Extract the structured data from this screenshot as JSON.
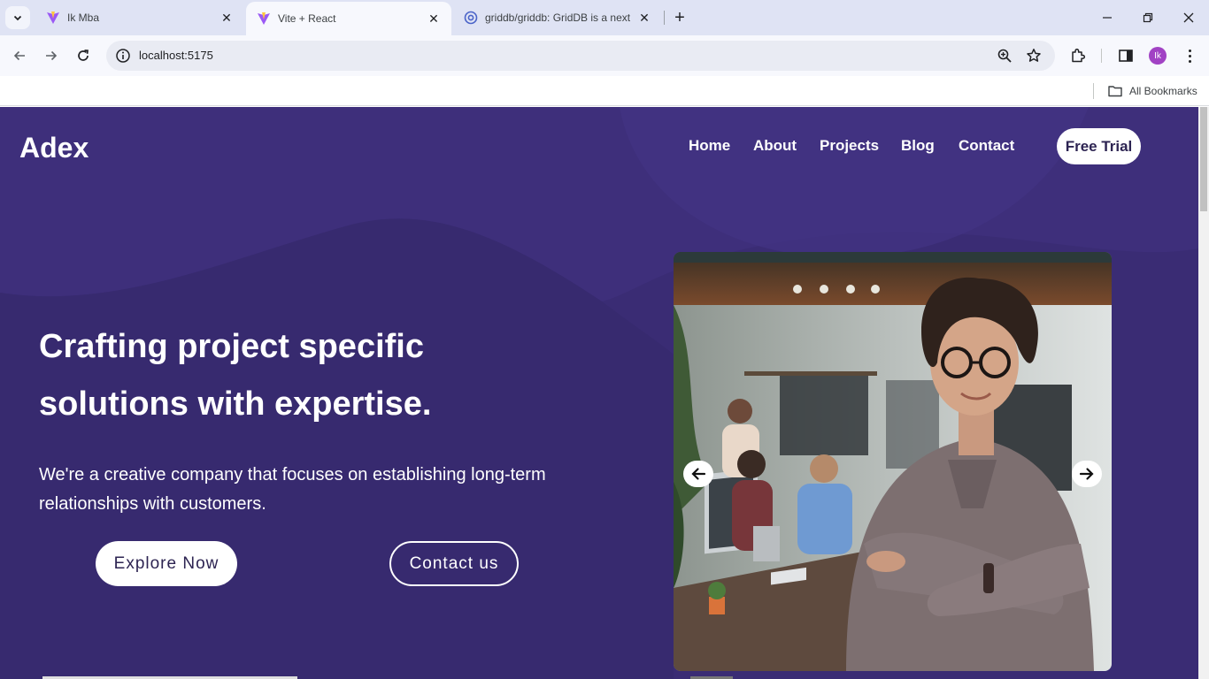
{
  "browser": {
    "tabs": [
      {
        "title": "Ik Mba",
        "icon": "vite-icon",
        "active": false
      },
      {
        "title": "Vite + React",
        "icon": "vite-icon",
        "active": true
      },
      {
        "title": "griddb/griddb: GridDB is a next",
        "icon": "github-icon",
        "active": false
      }
    ],
    "url": "localhost:5175",
    "profile_initials": "Ik",
    "bookmarks_label": "All Bookmarks"
  },
  "site": {
    "logo": "Adex",
    "nav": [
      "Home",
      "About",
      "Projects",
      "Blog",
      "Contact"
    ],
    "cta": "Free Trial"
  },
  "hero": {
    "title_line1": "Crafting project specific",
    "title_line2": "solutions with expertise.",
    "text_line1": "We're a creative company that focuses on establishing long-term",
    "text_line2": "relationships with customers.",
    "primary_button": "Explore Now",
    "secondary_button": "Contact us"
  },
  "colors": {
    "hero_bg": "#3a2c74",
    "button_text": "#2d2452"
  }
}
